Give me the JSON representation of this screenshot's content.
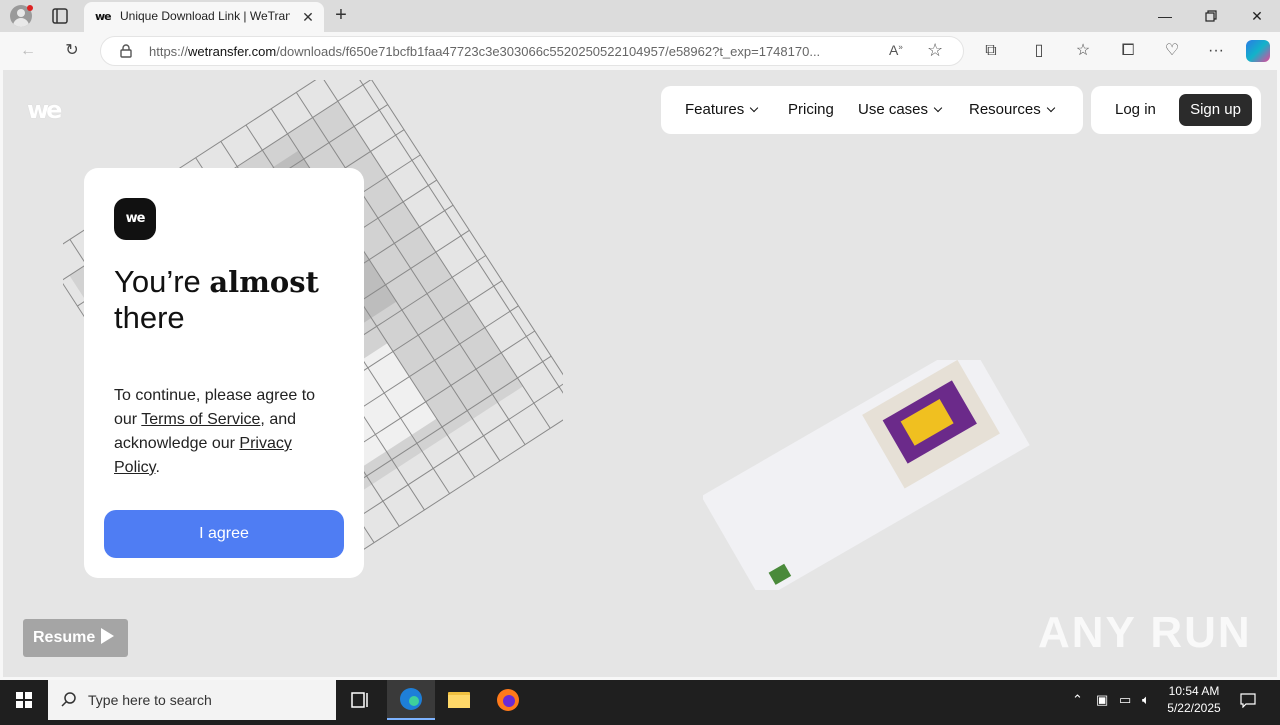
{
  "tab": {
    "title": "Unique Download Link | WeTransfer",
    "favicon_text": "we"
  },
  "address_bar": {
    "url_prefix": "https://",
    "url_domain": "wetransfer.com",
    "url_path": "/downloads/f650e71bcfb1faa47723c3e303066c5520250522104957/e58962?t_exp=1748170..."
  },
  "site": {
    "logo_text": "we",
    "nav": {
      "features": "Features",
      "pricing": "Pricing",
      "use_cases": "Use cases",
      "resources": "Resources"
    },
    "auth": {
      "login": "Log in",
      "signup": "Sign up"
    }
  },
  "consent_card": {
    "logo_text": "we",
    "heading_normal": "You’re",
    "heading_bold": "almost",
    "heading_line2": "there",
    "body_start": "To continue, please agree to our",
    "terms_link": "Terms of Service",
    "body_mid": ", and acknowledge our",
    "privacy_link": "Privacy Policy",
    "body_end": ".",
    "agree_button": "I agree"
  },
  "overlay": {
    "resume_label": "Resume",
    "watermark": "ANY RUN"
  },
  "taskbar": {
    "search_placeholder": "Type here to search",
    "time": "10:54 AM",
    "date": "5/22/2025"
  },
  "colors": {
    "agree_button": "#4f7df3",
    "signup_button": "#2b2b2b",
    "page_background": "#e5e5e5"
  }
}
